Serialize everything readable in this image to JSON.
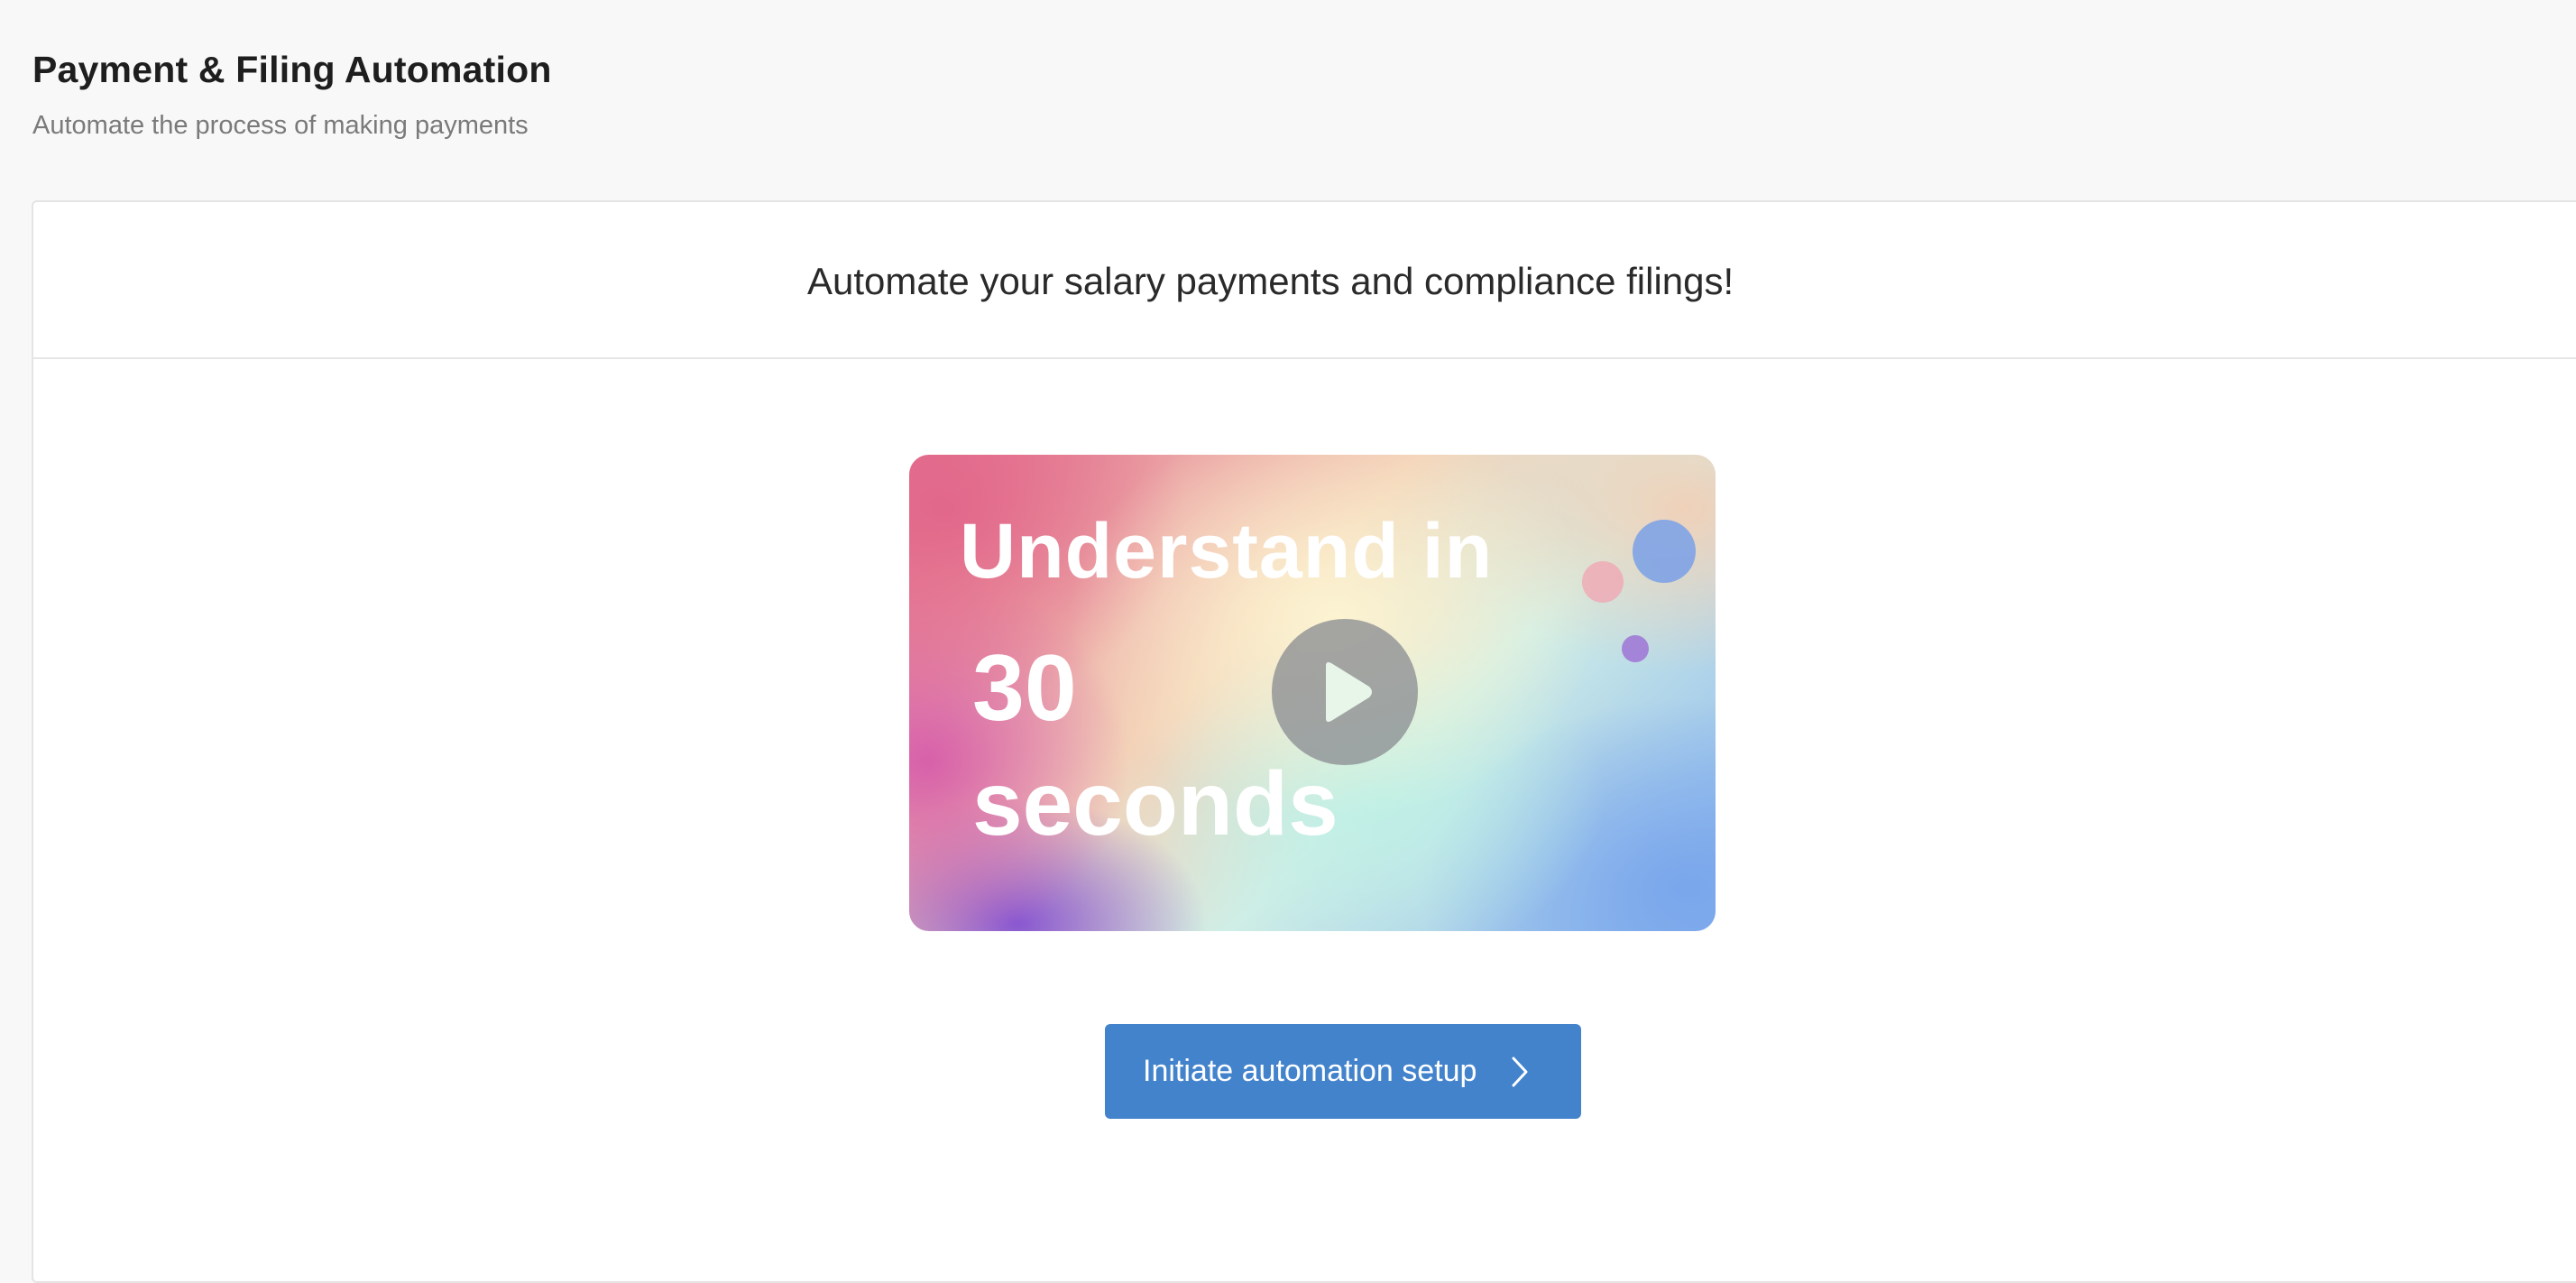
{
  "page": {
    "title": "Payment & Filing Automation",
    "subtitle": "Automate the process of making payments"
  },
  "card": {
    "heading": "Automate your salary payments and compliance filings!"
  },
  "video": {
    "line1": "Understand in",
    "line2": "30",
    "line3": "seconds",
    "play_icon": "play-icon"
  },
  "cta": {
    "label": "Initiate automation setup",
    "icon": "chevron-right-icon"
  },
  "colors": {
    "background": "#f8f8f8",
    "card": "#ffffff",
    "accent": "#4383cc",
    "title_text": "#1e1e1e",
    "subtitle_text": "#7a7a7a"
  }
}
